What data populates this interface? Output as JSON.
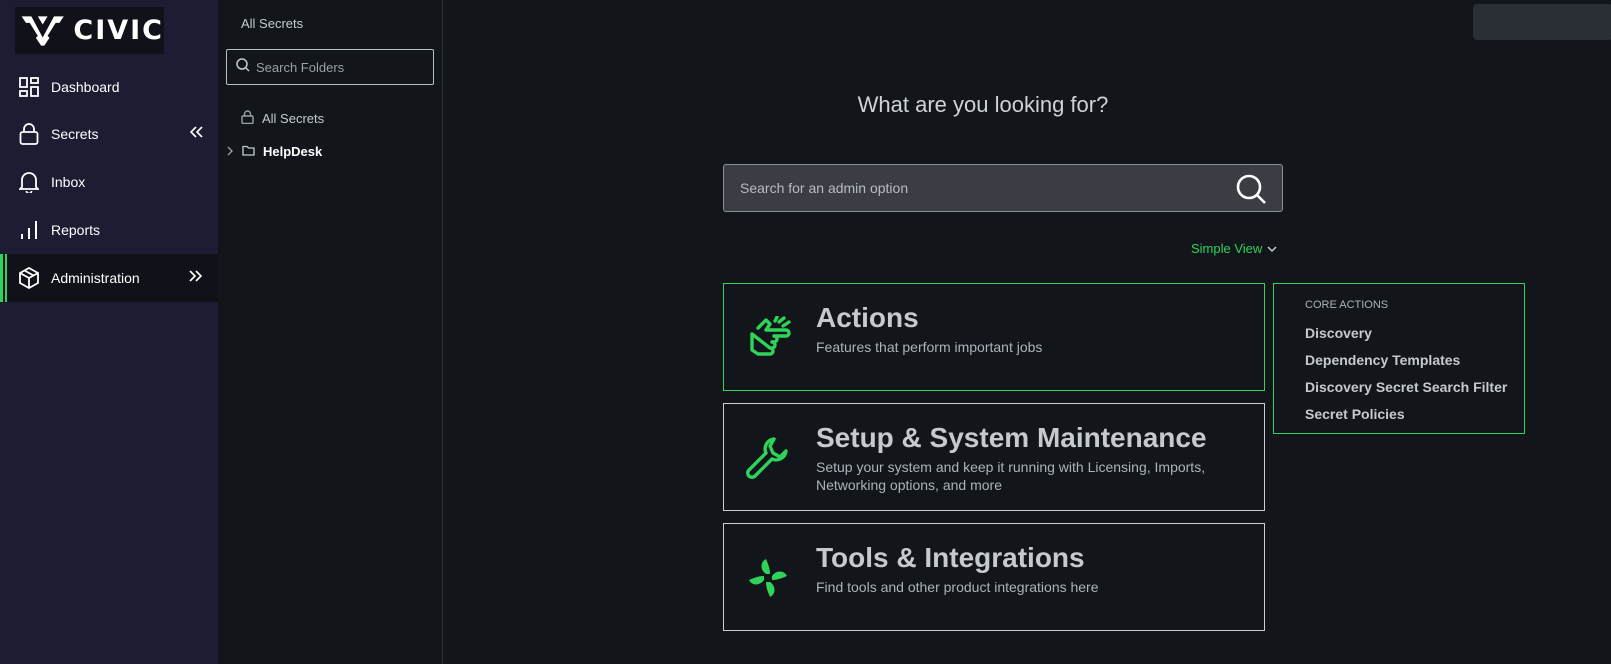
{
  "brand": {
    "name": "CIVIC"
  },
  "nav": {
    "items": [
      {
        "label": "Dashboard",
        "icon": "dashboard-icon"
      },
      {
        "label": "Secrets",
        "icon": "lock-icon"
      },
      {
        "label": "Inbox",
        "icon": "bell-icon"
      },
      {
        "label": "Reports",
        "icon": "bar-chart-icon"
      },
      {
        "label": "Administration",
        "icon": "cube-icon",
        "active": true
      }
    ]
  },
  "folders": {
    "title": "All Secrets",
    "search_placeholder": "Search Folders",
    "tree": [
      {
        "label": "All Secrets",
        "icon": "lock-icon"
      },
      {
        "label": "HelpDesk",
        "icon": "folder-icon",
        "collapsed": true
      }
    ]
  },
  "main": {
    "headline": "What are you looking for?",
    "search_placeholder": "Search for an admin option",
    "view_toggle": "Simple View",
    "cards": [
      {
        "title": "Actions",
        "description": "Features that perform important jobs",
        "icon": "hand-pointing-icon",
        "selected": true
      },
      {
        "title": "Setup & System Maintenance",
        "description": "Setup your system and keep it running with Licensing, Imports, Networking options, and more",
        "icon": "wrench-icon"
      },
      {
        "title": "Tools & Integrations",
        "description": "Find tools and other product integrations here",
        "icon": "pinwheel-icon"
      }
    ],
    "core_actions": {
      "heading": "CORE ACTIONS",
      "links": [
        "Discovery",
        "Dependency Templates",
        "Discovery Secret Search Filter",
        "Secret Policies"
      ]
    }
  },
  "colors": {
    "accent": "#2fd35a",
    "nav_bg": "#1c1d33",
    "page_bg": "#12161a"
  }
}
